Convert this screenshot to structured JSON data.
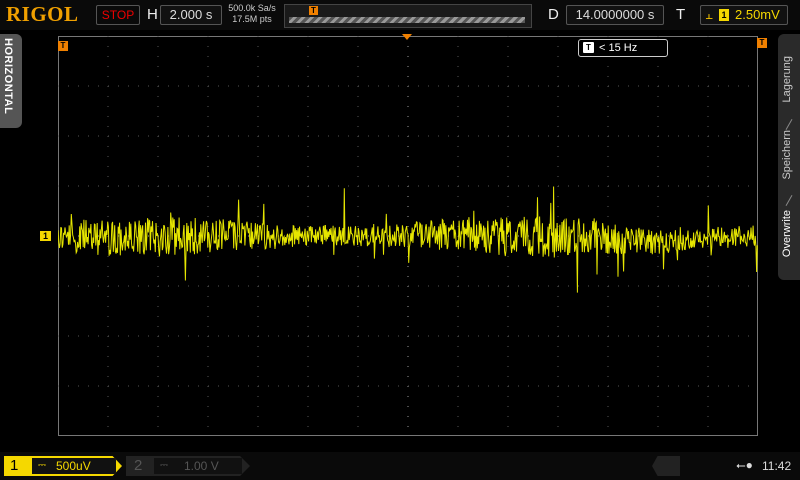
{
  "header": {
    "brand": "RIGOL",
    "run_state": "STOP",
    "horizontal_label": "H",
    "timebase": "2.000 s",
    "sample_rate": "500.0k Sa/s",
    "memory_depth": "17.5M pts",
    "delay_label": "D",
    "delay": "14.0000000 s",
    "trigger_label": "T",
    "trigger_source": "1",
    "trigger_level": "2.50mV",
    "trigger_marker": "T"
  },
  "left_panel": {
    "tab": "HORIZONTAL"
  },
  "right_panel": {
    "items": [
      "Lagerung",
      "Speichern",
      "Overwrite"
    ]
  },
  "plot": {
    "filter_icon": "T",
    "filter": "< 15 Hz",
    "channel_marker": "1",
    "trace_color": "#e6e600"
  },
  "footer": {
    "ch1": {
      "num": "1",
      "coupling": "DC",
      "scale": "500uV"
    },
    "ch2": {
      "num": "2",
      "coupling": "DC",
      "scale": "1.00 V"
    },
    "time": "11:42"
  },
  "icons": [
    "usb-icon",
    "trigger-edge-icon",
    "filter-icon"
  ]
}
